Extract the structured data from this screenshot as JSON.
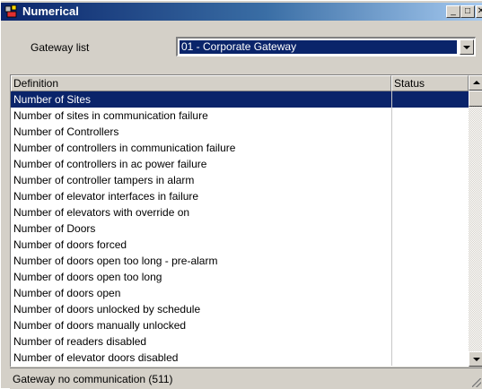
{
  "window": {
    "title": "Numerical",
    "icon": "app-icon",
    "controls": {
      "minimize": "_",
      "maximize": "□",
      "close": "✕"
    }
  },
  "gateway": {
    "label": "Gateway list",
    "selected": "01 - Corporate Gateway"
  },
  "table": {
    "columns": {
      "definition": "Definition",
      "status": "Status"
    },
    "rows": [
      {
        "definition": "Number of Sites",
        "status": "",
        "selected": true
      },
      {
        "definition": "Number of sites in communication failure",
        "status": ""
      },
      {
        "definition": "Number of Controllers",
        "status": ""
      },
      {
        "definition": "Number of controllers in communication failure",
        "status": ""
      },
      {
        "definition": "Number of controllers in ac power failure",
        "status": ""
      },
      {
        "definition": "Number of controller tampers in alarm",
        "status": ""
      },
      {
        "definition": "Number of elevator interfaces in failure",
        "status": ""
      },
      {
        "definition": "Number of elevators with override on",
        "status": ""
      },
      {
        "definition": "Number of Doors",
        "status": ""
      },
      {
        "definition": "Number of doors forced",
        "status": ""
      },
      {
        "definition": "Number of doors open too long - pre-alarm",
        "status": ""
      },
      {
        "definition": "Number of doors open too long",
        "status": ""
      },
      {
        "definition": "Number of doors open",
        "status": ""
      },
      {
        "definition": "Number of doors unlocked by schedule",
        "status": ""
      },
      {
        "definition": "Number of doors manually unlocked",
        "status": ""
      },
      {
        "definition": "Number of readers disabled",
        "status": ""
      },
      {
        "definition": "Number of elevator doors disabled",
        "status": ""
      }
    ]
  },
  "statusbar": {
    "text": "Gateway no communication (511)"
  },
  "colors": {
    "selection": "#0a246a",
    "face": "#d4d0c8",
    "title_start": "#0a246a",
    "title_end": "#a6caf0"
  }
}
